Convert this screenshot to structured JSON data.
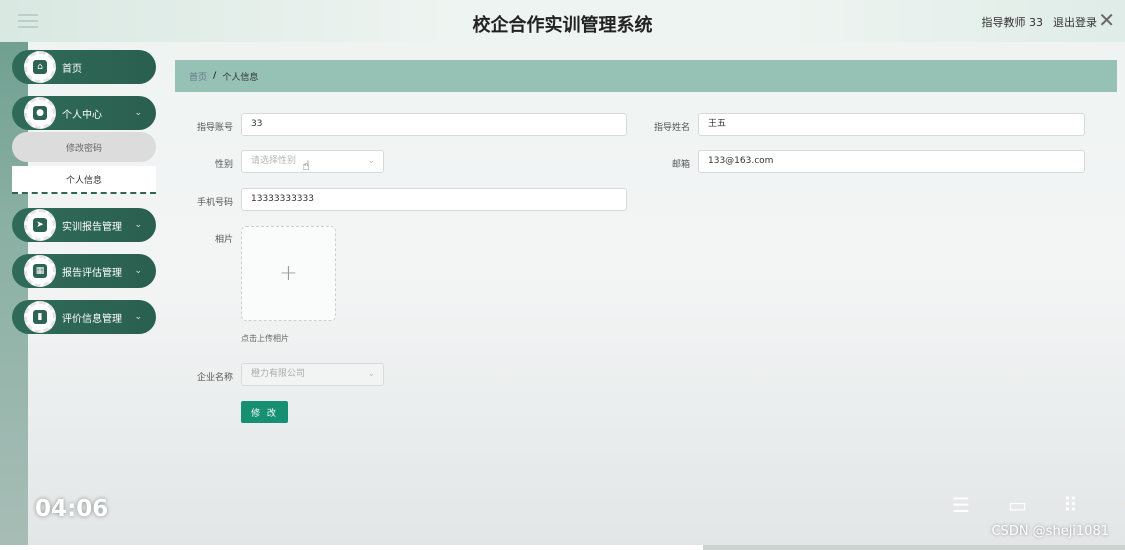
{
  "header": {
    "title": "校企合作实训管理系统",
    "user": "指导教师 33",
    "logout": "退出登录"
  },
  "sidebar": {
    "items": [
      {
        "label": "首页",
        "icon": "home-icon"
      },
      {
        "label": "个人中心",
        "icon": "user-icon"
      },
      {
        "label": "实训报告管理",
        "icon": "send-icon"
      },
      {
        "label": "报告评估管理",
        "icon": "grid-icon"
      },
      {
        "label": "评价信息管理",
        "icon": "chart-icon"
      }
    ],
    "sub_items": [
      "修改密码",
      "个人信息"
    ]
  },
  "breadcrumb": {
    "home": "首页",
    "separator": "/",
    "current": "个人信息"
  },
  "form": {
    "account_label": "指导账号",
    "account_value": "33",
    "name_label": "指导姓名",
    "name_value": "王五",
    "gender_label": "性别",
    "gender_placeholder": "请选择性别",
    "email_label": "邮箱",
    "email_value": "133@163.com",
    "phone_label": "手机号码",
    "phone_value": "13333333333",
    "photo_label": "相片",
    "upload_tip": "点击上传相片",
    "company_label": "企业名称",
    "company_value": "橙力有限公司",
    "edit_button": "修 改"
  },
  "video": {
    "time": "04:06",
    "watermark": "CSDN @sheji1081",
    "progress": 0.625
  }
}
